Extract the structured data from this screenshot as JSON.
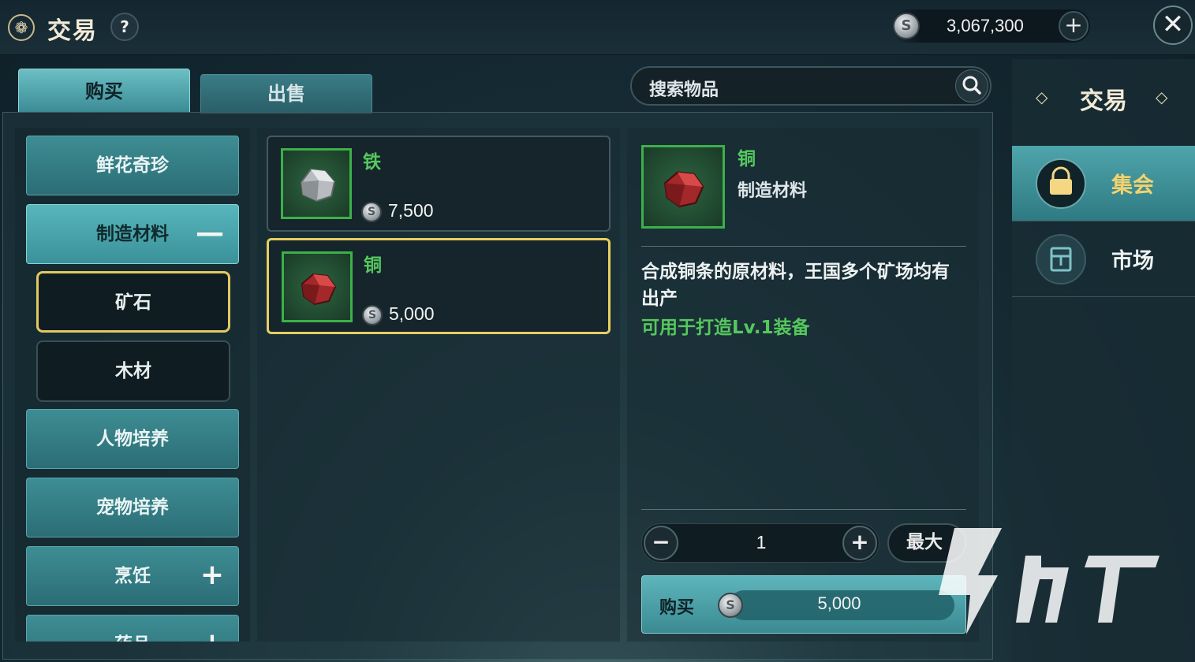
{
  "header": {
    "title": "交易",
    "help": "?",
    "currency_amount": "3,067,300",
    "currency_plus": "+",
    "close": "✕",
    "emblem": "❁"
  },
  "tabs": {
    "buy": "购买",
    "sell": "出售"
  },
  "search": {
    "placeholder": "搜索物品"
  },
  "categories": [
    {
      "label": "鲜花奇珍",
      "sign": ""
    },
    {
      "label": "制造材料",
      "sign": "—"
    },
    {
      "label": "人物培养",
      "sign": ""
    },
    {
      "label": "宠物培养",
      "sign": ""
    },
    {
      "label": "烹饪",
      "sign": "+"
    },
    {
      "label": "药品",
      "sign": "+"
    }
  ],
  "subcategories": [
    {
      "label": "矿石"
    },
    {
      "label": "木材"
    }
  ],
  "items": [
    {
      "name": "铁",
      "price": "7,500",
      "icon": "iron-ore-icon"
    },
    {
      "name": "铜",
      "price": "5,000",
      "icon": "copper-ore-icon"
    }
  ],
  "detail": {
    "name": "铜",
    "type": "制造材料",
    "description": "合成铜条的原材料，王国多个矿场均有出产",
    "usage": "可用于打造Lv.1装备",
    "quantity": "1",
    "minus": "−",
    "plus": "+",
    "max_label": "最大",
    "buy_label": "购买",
    "buy_price": "5,000"
  },
  "right_panel": {
    "title": "交易",
    "items": [
      {
        "label": "集会"
      },
      {
        "label": "市场"
      }
    ]
  },
  "coin_glyph": "S",
  "colors": {
    "accent_green": "#55c85e",
    "selection_gold": "#e6cf62",
    "teal_button": "#3c8c96"
  }
}
